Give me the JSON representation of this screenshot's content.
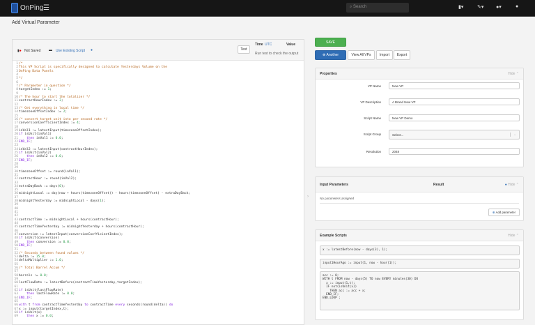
{
  "nav": {
    "brand": "OnPing",
    "search_placeholder": "Search"
  },
  "page_title": "Add Virtual Parameter",
  "editor": {
    "status": "Not Saved",
    "use_existing": "Use Existing Script",
    "test": "Test",
    "time_label": "Time",
    "time_zone": "UTC",
    "value_label": "Value",
    "hint": "Run test to check the output",
    "lines": [
      "/*",
      "This VP Script is specifically designed to calculate Yesterdays Volume on the",
      "OnPing Data Panels",
      "",
      "*/",
      "",
      "/* Parameter in question */",
      "targetIndex := 1;",
      "",
      "/* The hour to start the totalizer */",
      "contractHourIndex := 3;",
      "",
      "/* Get everything in local time */",
      "timezoneOffsetIndex := 2;",
      "",
      "/* convert target unit into per second rate */",
      "conversionCoefficientIndex := 4;",
      "",
      "inVal1 := latestInput(timezoneOffsetIndex);",
      "if isUnit(inVal1)",
      "    then inVal1 := 0.0;",
      "END_IF;",
      "",
      "inVal2 := latestInput(contractHourIndex);",
      "if isUnit(inVal2)",
      "    then inVal2 := 0.0;",
      "END_IF;",
      "",
      "",
      "timezoneOffset := round(inVal1);",
      "",
      "contractHour := round(inVal2);",
      "",
      "extraDayBack := days(0);",
      "",
      "midnightLocal := day(now + hours(timezoneOffset)) - hours(timezoneOffset) - extraDayBack;",
      "",
      "midnightYesterday := midnightLocal - days(1);",
      "",
      "",
      "",
      "",
      "contractTime := midnightLocal + hours(contractHour);",
      "",
      "contractTimeYesterday := midnightYesterday + hours(contractHour);",
      "",
      "conversion := latestInput(conversionCoefficientIndex);",
      "if isUnit(conversion)",
      "    then conversion := 0.0;",
      "END_IF;",
      "",
      "/* Seconds between found values */",
      "delta := 15.0;",
      "deltaMultiplier := 1.0;",
      "",
      "/* Total Barrel Accum */",
      "",
      "barrels := 0.0;",
      "",
      "lastFlowRate := latestBefore(contractTimeYesterday,targetIndex);",
      "",
      "if isUnit(lastFlowRate)",
      "    then lastFlowRate := 0.0;",
      "END_IF;",
      "",
      "with t from contractTimeYesterday to contractTime every seconds(round(delta)) do",
      "x := input(targetIndex,t);",
      "if isUnit(x)",
      "    then x := 0.0;"
    ]
  },
  "actions": {
    "save": "SAVE",
    "another": "Another",
    "view_all": "View All VPs",
    "import": "Import",
    "export": "Export"
  },
  "properties": {
    "title": "Properties",
    "hide": "Hide",
    "vp_name_label": "VP Name",
    "vp_name": "New VP",
    "vp_desc_label": "VP Description",
    "vp_desc": "A Brand New VP",
    "script_name_label": "Script Name",
    "script_name": "New VP Demo",
    "script_group_label": "Script Group",
    "script_group": "Select...",
    "resolution_label": "Resolution",
    "resolution": "2048"
  },
  "inputs": {
    "title": "Input Parameters",
    "result": "Result",
    "hide": "Hide",
    "empty": "No parameters assigned",
    "add": "Add parameter"
  },
  "examples": {
    "title": "Example Scripts",
    "hide": "Hide",
    "scripts": [
      "x := latestBefore(now - days(3), 1);",
      "input1HourAgo := input(1, now - hour(1));",
      "acc := 0;\nWITH t FROM now - days(5) TO now EVERY minutes(30) DO\n  x := input(1,t);\n  IF not(isUnit(x))\n    THEN acc := acc + x;\n  END_IF;\nEND_LOOP ;"
    ]
  },
  "colors": {
    "save": "#4caf50",
    "primary": "#2f6db5",
    "comment": "#b5651d",
    "keyword": "#8a2be2",
    "number": "#2a9d4a"
  }
}
